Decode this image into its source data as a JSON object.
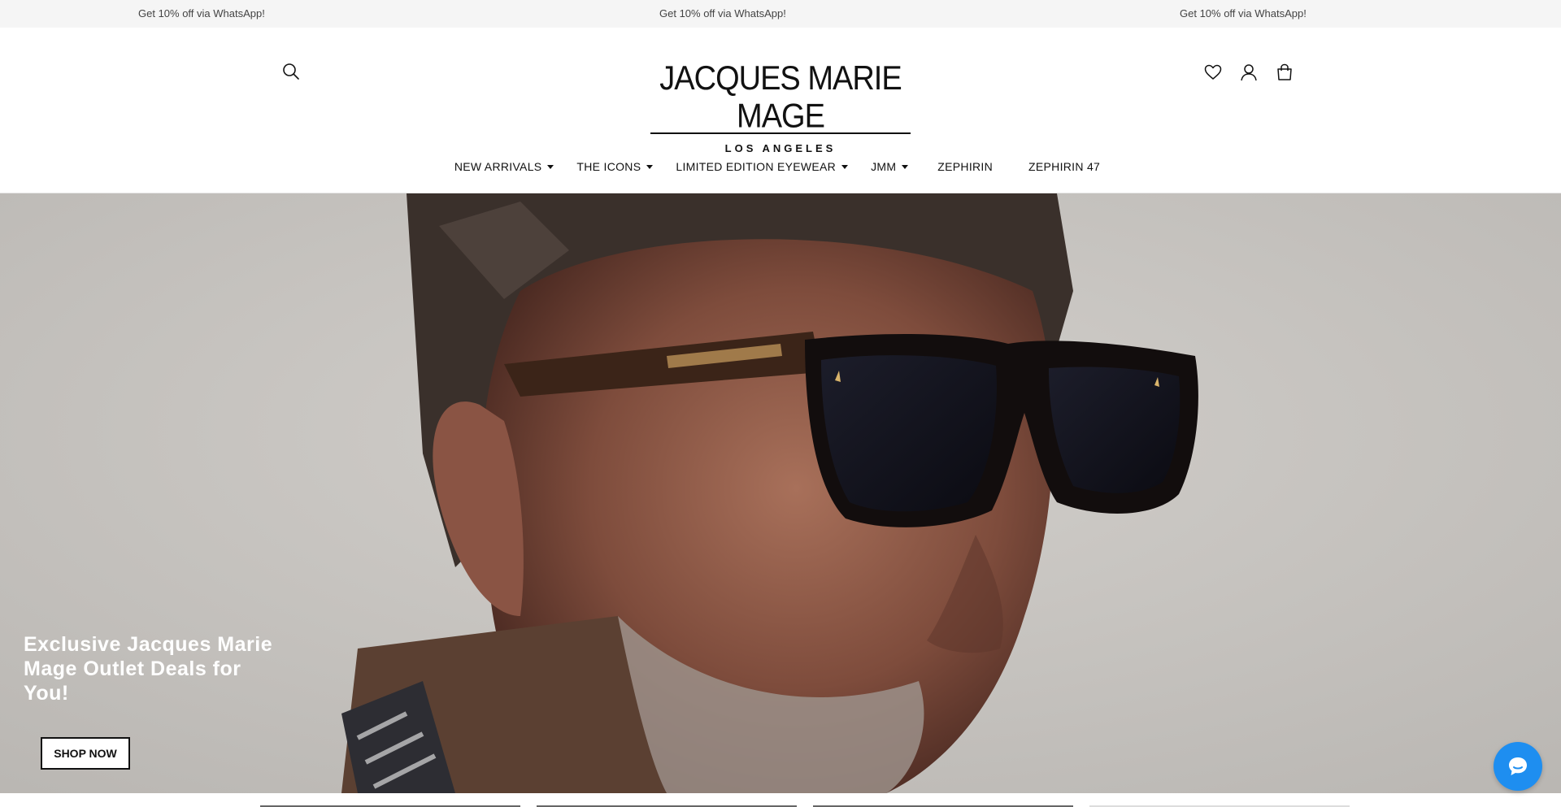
{
  "announcement": {
    "messages": [
      "Get 10% off via WhatsApp!",
      "Get 10% off via WhatsApp!",
      "Get 10% off via WhatsApp!"
    ]
  },
  "header": {
    "logo": {
      "brand": "JACQUES MARIE MAGE",
      "city": "LOS ANGELES"
    },
    "icons": {
      "search": "search-icon",
      "wishlist": "heart-icon",
      "account": "user-icon",
      "cart": "shopping-bag-icon"
    }
  },
  "nav": {
    "items": [
      {
        "label": "NEW ARRIVALS",
        "dropdown": true
      },
      {
        "label": "THE ICONS",
        "dropdown": true
      },
      {
        "label": "LIMITED EDITION EYEWEAR",
        "dropdown": true
      },
      {
        "label": "JMM",
        "dropdown": true
      },
      {
        "label": "ZEPHIRIN",
        "dropdown": false
      },
      {
        "label": "ZEPHIRIN 47",
        "dropdown": false
      }
    ]
  },
  "hero": {
    "title": "Exclusive Jacques Marie Mage Outlet Deals for You!",
    "button_label": "SHOP NOW"
  },
  "chat": {
    "icon": "chat-bubble-icon"
  },
  "colors": {
    "accent_chat": "#1e8ef0",
    "announce_bg": "#f5f5f5",
    "hero_bg": "#c8c5c1"
  }
}
